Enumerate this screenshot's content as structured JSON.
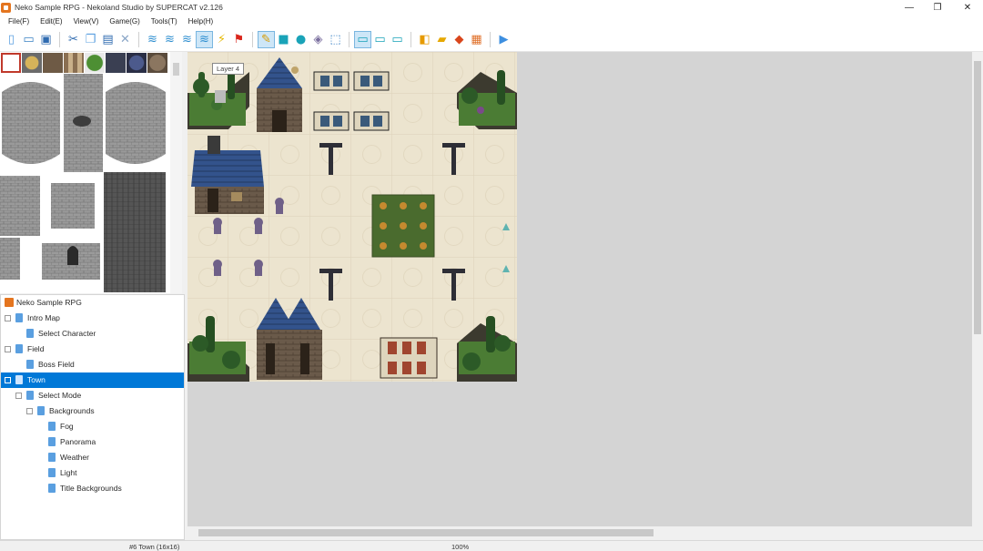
{
  "window": {
    "title": "Neko Sample RPG - Nekoland Studio by SUPERCAT v2.126",
    "minimize": "—",
    "restore": "❐",
    "close": "✕"
  },
  "menu": [
    "File(F)",
    "Edit(E)",
    "View(V)",
    "Game(G)",
    "Tools(T)",
    "Help(H)"
  ],
  "toolbar": {
    "groups": [
      [
        "new-file-icon",
        "open-project-icon",
        "save-icon"
      ],
      [
        "cut-icon",
        "copy-icon",
        "paste-icon",
        "delete-icon"
      ],
      [
        "layer-1-icon",
        "layer-2-icon",
        "layer-3-icon",
        "layer-4-icon",
        "event-layer-icon",
        "start-position-icon"
      ],
      [
        "pencil-icon",
        "rectangle-icon",
        "ellipse-icon",
        "fill-icon",
        "select-icon"
      ],
      [
        "zoom-1-icon",
        "zoom-2-icon",
        "zoom-3-icon"
      ],
      [
        "database-icon",
        "resource-icon",
        "script-icon",
        "material-icon"
      ],
      [
        "play-icon"
      ]
    ],
    "active": [
      "layer-4-icon",
      "pencil-icon",
      "zoom-1-icon"
    ]
  },
  "tooltip": "Layer 4",
  "tree": {
    "root": "Neko Sample RPG",
    "nodes": [
      {
        "label": "Intro Map",
        "depth": 1,
        "expander": true
      },
      {
        "label": "Select Character",
        "depth": 2,
        "expander": false
      },
      {
        "label": "Field",
        "depth": 1,
        "expander": true
      },
      {
        "label": "Boss Field",
        "depth": 2,
        "expander": false
      },
      {
        "label": "Town",
        "depth": 1,
        "expander": true,
        "selected": true
      },
      {
        "label": "Select Mode",
        "depth": 2,
        "expander": true
      },
      {
        "label": "Backgrounds",
        "depth": 3,
        "expander": true
      },
      {
        "label": "Fog",
        "depth": 4,
        "expander": false
      },
      {
        "label": "Panorama",
        "depth": 4,
        "expander": false
      },
      {
        "label": "Weather",
        "depth": 4,
        "expander": false
      },
      {
        "label": "Light",
        "depth": 4,
        "expander": false
      },
      {
        "label": "Title Backgrounds",
        "depth": 4,
        "expander": false
      }
    ]
  },
  "status": {
    "map": "#6 Town (16x16)",
    "zoom": "100%"
  },
  "colors": {
    "accent": "#0078d7",
    "canvas_bg": "#d4d4d4",
    "map_floor": "#ece4cf",
    "roof_blue": "#2f4f86",
    "grass": "#4a7d35",
    "tree": "#2f5a2a"
  }
}
